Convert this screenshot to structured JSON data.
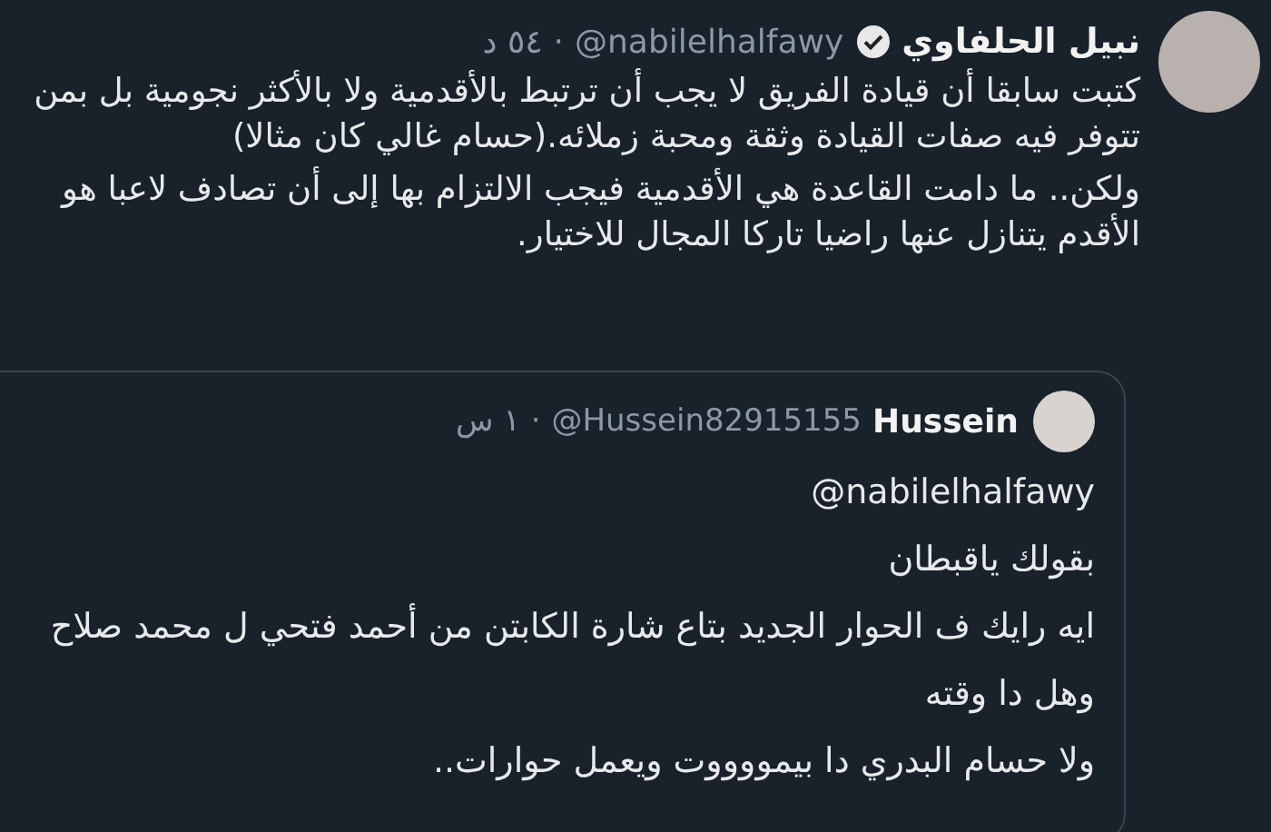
{
  "tweet": {
    "author": {
      "name": "نبيل الحلفاوي",
      "verified": true,
      "handle": "@nabilelhalfawy",
      "separator": "·",
      "time": "٥٤ د"
    },
    "paragraphs": [
      "كتبت سابقا أن قيادة الفريق لا يجب أن ترتبط بالأقدمية ولا بالأكثر نجومية بل بمن تتوفر فيه صفات القيادة وثقة ومحبة زملائه.(حسام غالي كان مثالا)",
      "ولكن.. ما دامت القاعدة هي الأقدمية فيجب الالتزام بها إلى أن تصادف لاعبا هو الأقدم يتنازل عنها راضيا تاركا المجال للاختيار."
    ],
    "quoted": {
      "author": {
        "name": "Hussein",
        "handle": "@Hussein82915155",
        "separator": "·",
        "time": "١ س"
      },
      "lines": [
        "@nabilelhalfawy",
        "بقولك ياقبطان",
        "ايه رايك ف الحوار  الجديد بتاع شارة الكابتن من أحمد فتحي ل محمد صلاح",
        "وهل دا وقته",
        "ولا حسام البدري دا بيمووووت ويعمل حوارات.."
      ]
    }
  }
}
